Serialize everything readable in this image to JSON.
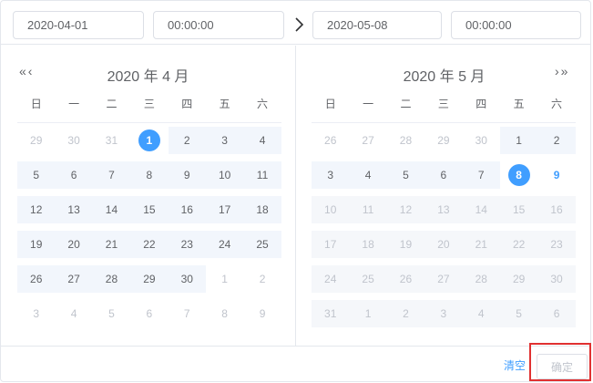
{
  "header": {
    "start_date": "2020-04-01",
    "start_time": "00:00:00",
    "end_date": "2020-05-08",
    "end_time": "00:00:00"
  },
  "left_calendar": {
    "title": "2020 年 4 月",
    "weekdays": [
      "日",
      "一",
      "二",
      "三",
      "四",
      "五",
      "六"
    ],
    "weeks": [
      [
        {
          "d": "29",
          "s": "muted"
        },
        {
          "d": "30",
          "s": "muted"
        },
        {
          "d": "31",
          "s": "muted"
        },
        {
          "d": "1",
          "s": "edge"
        },
        {
          "d": "2",
          "s": "in-range"
        },
        {
          "d": "3",
          "s": "in-range"
        },
        {
          "d": "4",
          "s": "in-range"
        }
      ],
      [
        {
          "d": "5",
          "s": "in-range"
        },
        {
          "d": "6",
          "s": "in-range"
        },
        {
          "d": "7",
          "s": "in-range"
        },
        {
          "d": "8",
          "s": "in-range"
        },
        {
          "d": "9",
          "s": "in-range"
        },
        {
          "d": "10",
          "s": "in-range"
        },
        {
          "d": "11",
          "s": "in-range"
        }
      ],
      [
        {
          "d": "12",
          "s": "in-range"
        },
        {
          "d": "13",
          "s": "in-range"
        },
        {
          "d": "14",
          "s": "in-range"
        },
        {
          "d": "15",
          "s": "in-range"
        },
        {
          "d": "16",
          "s": "in-range"
        },
        {
          "d": "17",
          "s": "in-range"
        },
        {
          "d": "18",
          "s": "in-range"
        }
      ],
      [
        {
          "d": "19",
          "s": "in-range"
        },
        {
          "d": "20",
          "s": "in-range"
        },
        {
          "d": "21",
          "s": "in-range"
        },
        {
          "d": "22",
          "s": "in-range"
        },
        {
          "d": "23",
          "s": "in-range"
        },
        {
          "d": "24",
          "s": "in-range"
        },
        {
          "d": "25",
          "s": "in-range"
        }
      ],
      [
        {
          "d": "26",
          "s": "in-range"
        },
        {
          "d": "27",
          "s": "in-range"
        },
        {
          "d": "28",
          "s": "in-range"
        },
        {
          "d": "29",
          "s": "in-range"
        },
        {
          "d": "30",
          "s": "in-range"
        },
        {
          "d": "1",
          "s": "muted"
        },
        {
          "d": "2",
          "s": "muted"
        }
      ],
      [
        {
          "d": "3",
          "s": "muted"
        },
        {
          "d": "4",
          "s": "muted"
        },
        {
          "d": "5",
          "s": "muted"
        },
        {
          "d": "6",
          "s": "muted"
        },
        {
          "d": "7",
          "s": "muted"
        },
        {
          "d": "8",
          "s": "muted"
        },
        {
          "d": "9",
          "s": "muted"
        }
      ]
    ]
  },
  "right_calendar": {
    "title": "2020 年 5 月",
    "weekdays": [
      "日",
      "一",
      "二",
      "三",
      "四",
      "五",
      "六"
    ],
    "weeks": [
      [
        {
          "d": "26",
          "s": "muted"
        },
        {
          "d": "27",
          "s": "muted"
        },
        {
          "d": "28",
          "s": "muted"
        },
        {
          "d": "29",
          "s": "muted"
        },
        {
          "d": "30",
          "s": "muted"
        },
        {
          "d": "1",
          "s": "in-range"
        },
        {
          "d": "2",
          "s": "in-range"
        }
      ],
      [
        {
          "d": "3",
          "s": "in-range"
        },
        {
          "d": "4",
          "s": "in-range"
        },
        {
          "d": "5",
          "s": "in-range"
        },
        {
          "d": "6",
          "s": "in-range"
        },
        {
          "d": "7",
          "s": "in-range"
        },
        {
          "d": "8",
          "s": "edge"
        },
        {
          "d": "9",
          "s": "today"
        }
      ],
      [
        {
          "d": "10",
          "s": "disabled"
        },
        {
          "d": "11",
          "s": "disabled"
        },
        {
          "d": "12",
          "s": "disabled"
        },
        {
          "d": "13",
          "s": "disabled"
        },
        {
          "d": "14",
          "s": "disabled"
        },
        {
          "d": "15",
          "s": "disabled"
        },
        {
          "d": "16",
          "s": "disabled"
        }
      ],
      [
        {
          "d": "17",
          "s": "disabled"
        },
        {
          "d": "18",
          "s": "disabled"
        },
        {
          "d": "19",
          "s": "disabled"
        },
        {
          "d": "20",
          "s": "disabled"
        },
        {
          "d": "21",
          "s": "disabled"
        },
        {
          "d": "22",
          "s": "disabled"
        },
        {
          "d": "23",
          "s": "disabled"
        }
      ],
      [
        {
          "d": "24",
          "s": "disabled"
        },
        {
          "d": "25",
          "s": "disabled"
        },
        {
          "d": "26",
          "s": "disabled"
        },
        {
          "d": "27",
          "s": "disabled"
        },
        {
          "d": "28",
          "s": "disabled"
        },
        {
          "d": "29",
          "s": "disabled"
        },
        {
          "d": "30",
          "s": "disabled"
        }
      ],
      [
        {
          "d": "31",
          "s": "disabled"
        },
        {
          "d": "1",
          "s": "disabled"
        },
        {
          "d": "2",
          "s": "disabled"
        },
        {
          "d": "3",
          "s": "disabled"
        },
        {
          "d": "4",
          "s": "disabled"
        },
        {
          "d": "5",
          "s": "disabled"
        },
        {
          "d": "6",
          "s": "disabled"
        }
      ]
    ]
  },
  "nav": {
    "prev_year": "«",
    "prev_month": "‹",
    "next_month": "›",
    "next_year": "»"
  },
  "footer": {
    "clear_label": "清空",
    "confirm_label": "确定"
  },
  "colors": {
    "accent": "#409eff",
    "range_bg": "#f2f6fc",
    "disabled_bg": "#f5f7fa",
    "highlight_border": "#e03131"
  }
}
